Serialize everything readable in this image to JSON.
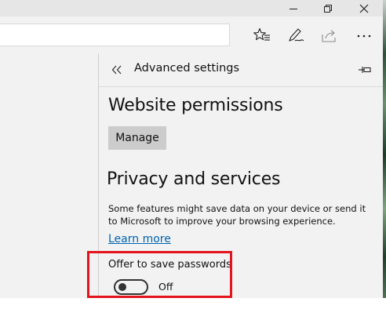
{
  "window_controls": {
    "minimize_icon": "minimize-icon",
    "restore_icon": "restore-icon",
    "close_icon": "close-icon"
  },
  "toolbar": {
    "address_value": "",
    "icons": [
      "favorites-star-icon",
      "web-note-pen-icon",
      "share-icon",
      "more-dots-icon"
    ]
  },
  "panel": {
    "title": "Advanced settings",
    "back_icon": "double-chevron-left-icon",
    "pin_icon": "pin-icon",
    "website_permissions": {
      "heading": "Website permissions",
      "manage_label": "Manage"
    },
    "privacy": {
      "heading": "Privacy and services",
      "description": "Some features might save data on your device or send it to Microsoft to improve your browsing experience.",
      "learn_more": "Learn more",
      "save_passwords": {
        "label": "Offer to save passwords",
        "enabled": false,
        "state_text": "Off"
      }
    }
  },
  "colors": {
    "panel_bg": "#f2f2f2",
    "link": "#0063b1",
    "highlight": "#e3141d",
    "button_bg": "#cccccc"
  }
}
